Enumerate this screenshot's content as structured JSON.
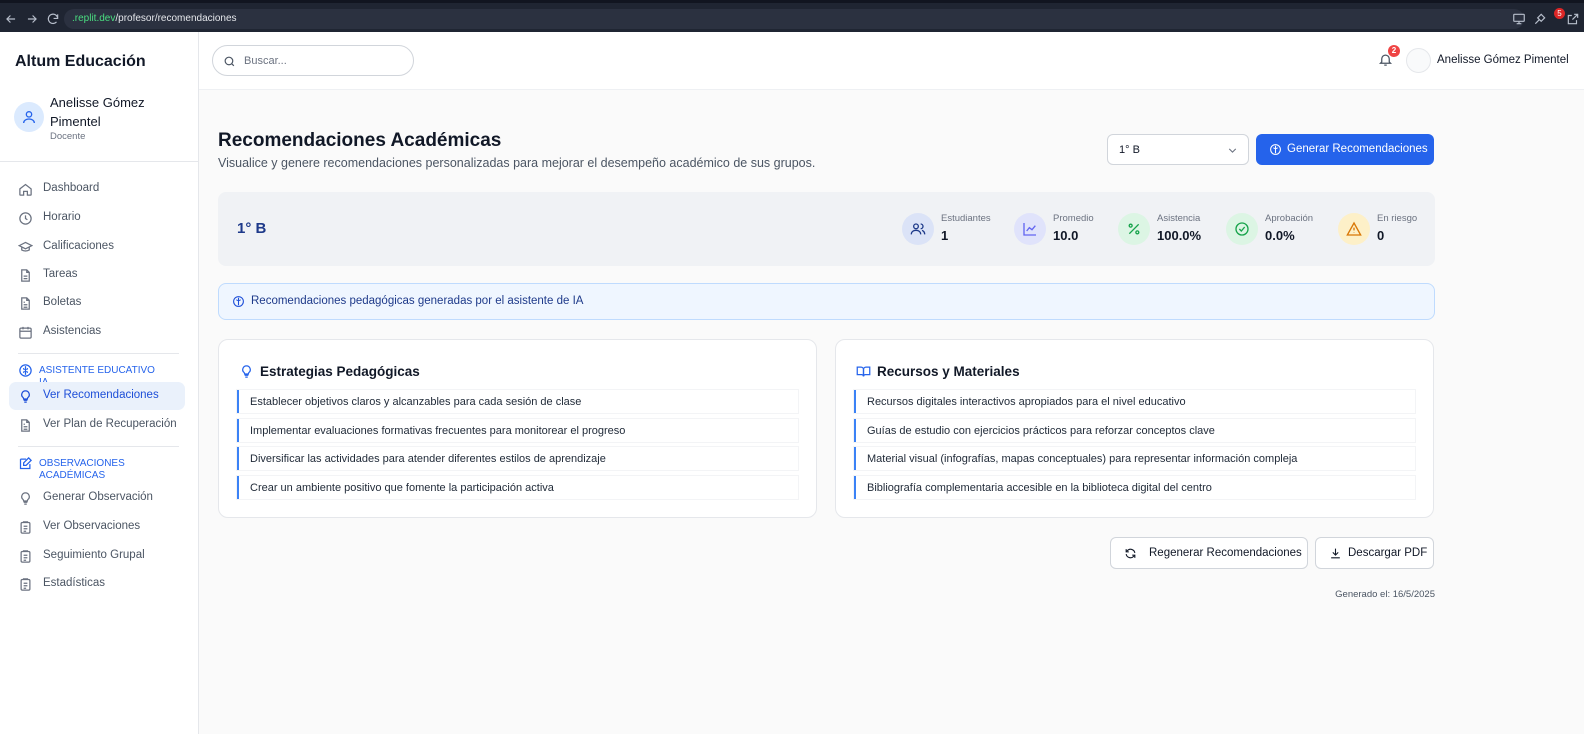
{
  "browser": {
    "url_domain": ".replit.dev",
    "url_path": "/profesor/recomendaciones",
    "extension_badge": "5"
  },
  "sidebar": {
    "brand": "Altum Educación",
    "user_name": "Anelisse Gómez Pimentel",
    "user_role": "Docente",
    "items": [
      {
        "label": "Dashboard",
        "icon": "home-icon"
      },
      {
        "label": "Horario",
        "icon": "clock-icon"
      },
      {
        "label": "Calificaciones",
        "icon": "graduation-cap-icon"
      },
      {
        "label": "Tareas",
        "icon": "file-icon"
      },
      {
        "label": "Boletas",
        "icon": "file-text-icon"
      },
      {
        "label": "Asistencias",
        "icon": "calendar-icon"
      }
    ],
    "section_ai": {
      "title": "ASISTENTE EDUCATIVO IA",
      "items": [
        {
          "label": "Ver Recomendaciones",
          "icon": "lightbulb-icon",
          "active": true
        },
        {
          "label": "Ver Plan de Recuperación",
          "icon": "file-text-icon"
        }
      ]
    },
    "section_obs": {
      "title": "OBSERVACIONES ACADÉMICAS",
      "items": [
        {
          "label": "Generar Observación",
          "icon": "lightbulb-icon"
        },
        {
          "label": "Ver Observaciones",
          "icon": "clipboard-icon"
        },
        {
          "label": "Seguimiento Grupal",
          "icon": "clipboard-icon"
        },
        {
          "label": "Estadísticas",
          "icon": "clipboard-icon"
        }
      ]
    }
  },
  "topbar": {
    "search_placeholder": "Buscar...",
    "notifications_count": "2",
    "user_name": "Anelisse Gómez Pimentel"
  },
  "page": {
    "title": "Recomendaciones Académicas",
    "subtitle": "Visualice y genere recomendaciones personalizadas para mejorar el desempeño académico de sus grupos.",
    "group_select": "1° B",
    "generate_label": "Generar Recomendaciones"
  },
  "summary": {
    "group": "1° B",
    "stats": [
      {
        "label": "Estudiantes",
        "value": "1",
        "icon": "users-icon",
        "color": "#4f46e5"
      },
      {
        "label": "Promedio",
        "value": "10.0",
        "icon": "line-chart-icon",
        "color": "#6366f1"
      },
      {
        "label": "Asistencia",
        "value": "100.0%",
        "icon": "percent-icon",
        "color": "#16a34a"
      },
      {
        "label": "Aprobación",
        "value": "0.0%",
        "icon": "check-circle-icon",
        "color": "#16a34a"
      },
      {
        "label": "En riesgo",
        "value": "0",
        "icon": "warning-icon",
        "color": "#d97706"
      }
    ]
  },
  "info_banner": "Recomendaciones pedagógicas generadas por el asistente de IA",
  "cards": [
    {
      "title": "Estrategias Pedagógicas",
      "icon": "lightbulb-icon",
      "items": [
        "Establecer objetivos claros y alcanzables para cada sesión de clase",
        "Implementar evaluaciones formativas frecuentes para monitorear el progreso",
        "Diversificar las actividades para atender diferentes estilos de aprendizaje",
        "Crear un ambiente positivo que fomente la participación activa"
      ]
    },
    {
      "title": "Recursos y Materiales",
      "icon": "book-open-icon",
      "items": [
        "Recursos digitales interactivos apropiados para el nivel educativo",
        "Guías de estudio con ejercicios prácticos para reforzar conceptos clave",
        "Material visual (infografías, mapas conceptuales) para representar información compleja",
        "Bibliografía complementaria accesible en la biblioteca digital del centro"
      ]
    }
  ],
  "actions": {
    "regenerate": "Regenerar Recomendaciones",
    "download": "Descargar PDF"
  },
  "generated": "Generado el: 16/5/2025",
  "colors": {
    "accent": "#2563eb",
    "sidebar_active_bg": "#eaf1fb",
    "info_bg": "#eff6ff"
  }
}
